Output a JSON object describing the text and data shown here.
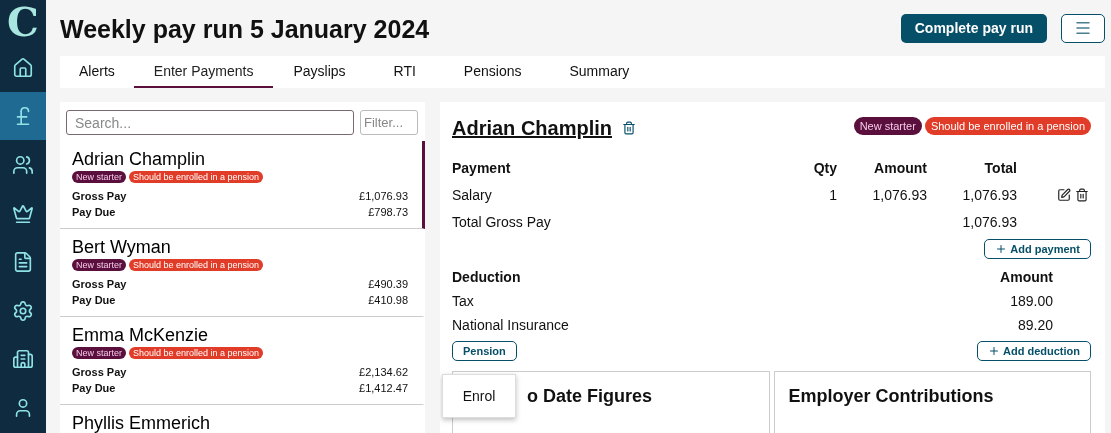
{
  "sidebar": {
    "logo": "C",
    "items": [
      {
        "selected": false
      },
      {
        "selected": true
      },
      {
        "selected": false
      },
      {
        "selected": false
      },
      {
        "selected": false
      },
      {
        "selected": false
      },
      {
        "selected": false
      },
      {
        "selected": false
      }
    ]
  },
  "header": {
    "title": "Weekly pay run 5 January 2024",
    "primary_button": "Complete pay run"
  },
  "tabs": [
    {
      "label": "Alerts",
      "selected": false
    },
    {
      "label": "Enter Payments",
      "selected": true
    },
    {
      "label": "Payslips",
      "selected": false
    },
    {
      "label": "RTI",
      "selected": false
    },
    {
      "label": "Pensions",
      "selected": false
    },
    {
      "label": "Summary",
      "selected": false
    }
  ],
  "employee_list": {
    "search": {
      "placeholder": "Search..."
    },
    "filter": {
      "placeholder": "Filter..."
    },
    "employees": [
      {
        "name": "Adrian Champlin",
        "selected": true,
        "badges": [
          {
            "label": "New starter",
            "color": "#5a0f3c"
          },
          {
            "label": "Should be enrolled in a pension",
            "color": "#e03c28"
          }
        ],
        "rows": [
          {
            "label": "Gross Pay",
            "value": "£1,076.93"
          },
          {
            "label": "Pay Due",
            "value": "£798.73"
          }
        ]
      },
      {
        "name": "Bert Wyman",
        "selected": false,
        "badges": [
          {
            "label": "New starter",
            "color": "#5a0f3c"
          },
          {
            "label": "Should be enrolled in a pension",
            "color": "#e03c28"
          }
        ],
        "rows": [
          {
            "label": "Gross Pay",
            "value": "£490.39"
          },
          {
            "label": "Pay Due",
            "value": "£410.98"
          }
        ]
      },
      {
        "name": "Emma McKenzie",
        "selected": false,
        "badges": [
          {
            "label": "New starter",
            "color": "#5a0f3c"
          },
          {
            "label": "Should be enrolled in a pension",
            "color": "#e03c28"
          }
        ],
        "rows": [
          {
            "label": "Gross Pay",
            "value": "£2,134.62"
          },
          {
            "label": "Pay Due",
            "value": "£1,412.47"
          }
        ]
      },
      {
        "name": "Phyllis Emmerich",
        "selected": false
      }
    ]
  },
  "detail": {
    "name": "Adrian Champlin",
    "badges": [
      {
        "label": "New starter",
        "color": "#5a0f3c"
      },
      {
        "label": "Should be enrolled in a pension",
        "color": "#e03c28"
      }
    ],
    "payments": {
      "columns": [
        "Payment",
        "Qty",
        "Amount",
        "Total"
      ],
      "rows": [
        {
          "name": "Salary",
          "qty": "1",
          "amount": "1,076.93",
          "total": "1,076.93",
          "editable": true
        }
      ],
      "total": {
        "label": "Total Gross Pay",
        "value": "1,076.93"
      },
      "add_button": "Add payment"
    },
    "deductions": {
      "columns": [
        "Deduction",
        "Amount"
      ],
      "rows": [
        {
          "name": "Tax",
          "amount": "189.00"
        },
        {
          "name": "National Insurance",
          "amount": "89.20"
        }
      ],
      "pension_button": "Pension",
      "add_button": "Add deduction"
    },
    "pension_menu": {
      "items": [
        "Enrol"
      ]
    },
    "cards": [
      {
        "title": "o Date Figures"
      },
      {
        "title": "Employer Contributions"
      }
    ]
  }
}
